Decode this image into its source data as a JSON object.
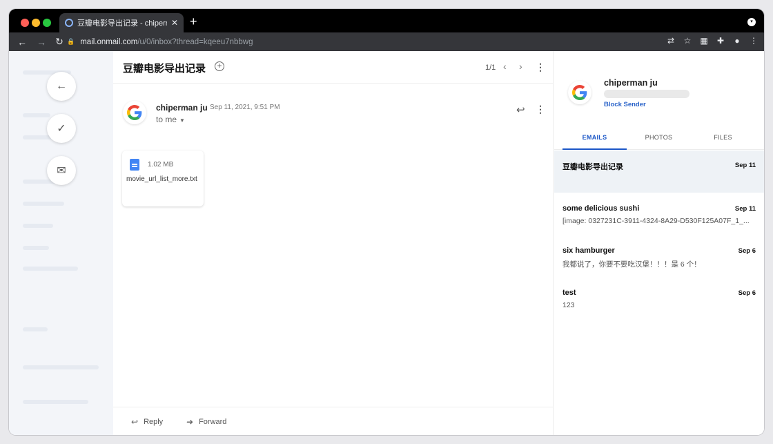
{
  "browser": {
    "tab_title": "豆瓣电影导出记录 - chipermanju",
    "tab_close": "✕",
    "new_tab": "+",
    "url_host": "mail.onmail.com",
    "url_path": "/u/0/inbox?thread=kqeeu7nbbwg"
  },
  "rail": {
    "back": "←",
    "done": "✓",
    "mail": "✉"
  },
  "email": {
    "subject": "豆瓣电影导出记录",
    "add": "+",
    "pager": "1/1",
    "prev": "‹",
    "next": "›",
    "more": "⋮",
    "sender_name": "chiperman ju",
    "date": "Sep 11, 2021, 9:51 PM",
    "to": "to me",
    "reply_icon": "↩",
    "attachment": {
      "size": "1.02 MB",
      "name": "movie_url_list_more.txt"
    },
    "footer": {
      "reply": "Reply",
      "forward": "Forward"
    }
  },
  "contact": {
    "name": "chiperman ju",
    "block": "Block Sender",
    "tabs": [
      "EMAILS",
      "PHOTOS",
      "FILES"
    ],
    "threads": [
      {
        "subject": "豆瓣电影导出记录",
        "date": "Sep 11",
        "preview": ""
      },
      {
        "subject": "some delicious sushi",
        "date": "Sep 11",
        "preview": "[image: 0327231C-3911-4324-8A29-D530F125A07F_1_..."
      },
      {
        "subject": "six hamburger",
        "date": "Sep 6",
        "preview": "我都说了，你要不要吃汉堡！！！是 6 个！"
      },
      {
        "subject": "test",
        "date": "Sep 6",
        "preview": "123"
      }
    ]
  },
  "colors": {
    "accent": "#1a56c7",
    "sidebar_bg": "#f3f5f9"
  }
}
